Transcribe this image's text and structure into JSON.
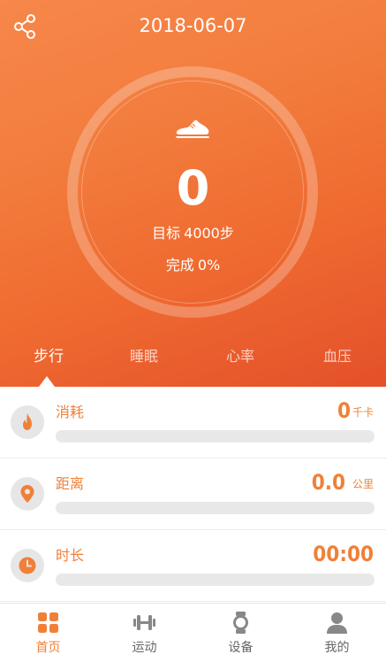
{
  "header": {
    "date": "2018-06-07"
  },
  "ring": {
    "steps": "0",
    "goal_label": "目标",
    "goal_value": "4000步",
    "complete_label": "完成",
    "complete_value": "0%"
  },
  "tabs": [
    {
      "label": "步行",
      "active": true
    },
    {
      "label": "睡眠",
      "active": false
    },
    {
      "label": "心率",
      "active": false
    },
    {
      "label": "血压",
      "active": false
    }
  ],
  "metrics": [
    {
      "label": "消耗",
      "value": "0",
      "unit": "千卡",
      "icon": "flame-icon",
      "progress": 0
    },
    {
      "label": "距离",
      "value": "0.0",
      "unit": "公里",
      "icon": "location-pin-icon",
      "progress": 0
    },
    {
      "label": "时长",
      "value": "00:00",
      "unit": "",
      "icon": "clock-icon",
      "progress": 0
    }
  ],
  "nav": [
    {
      "label": "首页",
      "icon": "home-grid-icon",
      "active": true
    },
    {
      "label": "运动",
      "icon": "dumbbell-icon",
      "active": false
    },
    {
      "label": "设备",
      "icon": "watch-icon",
      "active": false
    },
    {
      "label": "我的",
      "icon": "user-icon",
      "active": false
    }
  ],
  "colors": {
    "accent": "#f08038",
    "hero_start": "#f7874a",
    "hero_end": "#e4502a",
    "inactive": "#888888"
  }
}
